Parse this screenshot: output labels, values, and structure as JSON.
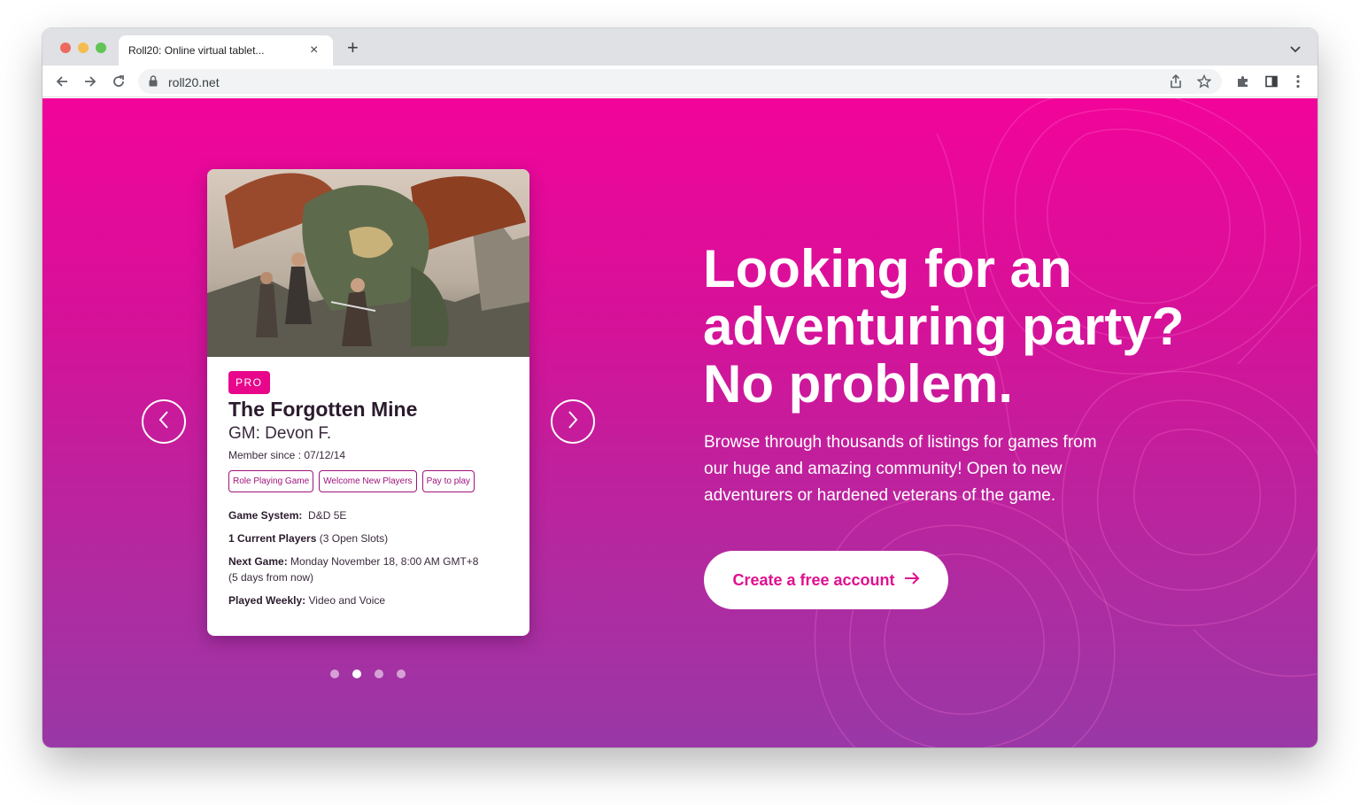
{
  "browser": {
    "tab_title": "Roll20: Online virtual tablet...",
    "tab_close": "×",
    "new_tab": "+",
    "url": "roll20.net",
    "icons": [
      "back-icon",
      "forward-icon",
      "reload-icon",
      "lock-icon",
      "share-icon",
      "star-icon",
      "extensions-icon",
      "sidepanel-icon",
      "menu-icon",
      "chevron-down-icon"
    ]
  },
  "carousel": {
    "card": {
      "badge": "PRO",
      "title": "The Forgotten Mine",
      "gm": "GM: Devon F.",
      "member_since": "Member since : 07/12/14",
      "tags": [
        "Role Playing Game",
        "Welcome New Players",
        "Pay to play"
      ],
      "game_system_label": "Game System:",
      "game_system_value": "D&D 5E",
      "players_label": "1 Current Players",
      "players_value": "(3 Open Slots)",
      "next_game_label": "Next Game:",
      "next_game_value": "Monday November 18, 8:00 AM GMT+8",
      "next_game_relative": "(5 days from now)",
      "played_label": "Played Weekly:",
      "played_value": "Video and Voice"
    },
    "total_slides": 4,
    "active_slide": 2
  },
  "hero": {
    "headline_lines": [
      "Looking for an",
      "adventuring party?",
      "No problem."
    ],
    "subtitle_lines": [
      "Browse through thousands of listings for games from",
      "our huge and amazing community! Open to new",
      "adventurers or hardened veterans of the game."
    ],
    "cta_label": "Create a free account"
  },
  "colors": {
    "brand_pink": "#e8068b",
    "gradient_top": "#f2049a",
    "gradient_bottom": "#9938a6",
    "tag_purple": "#a0137c"
  }
}
